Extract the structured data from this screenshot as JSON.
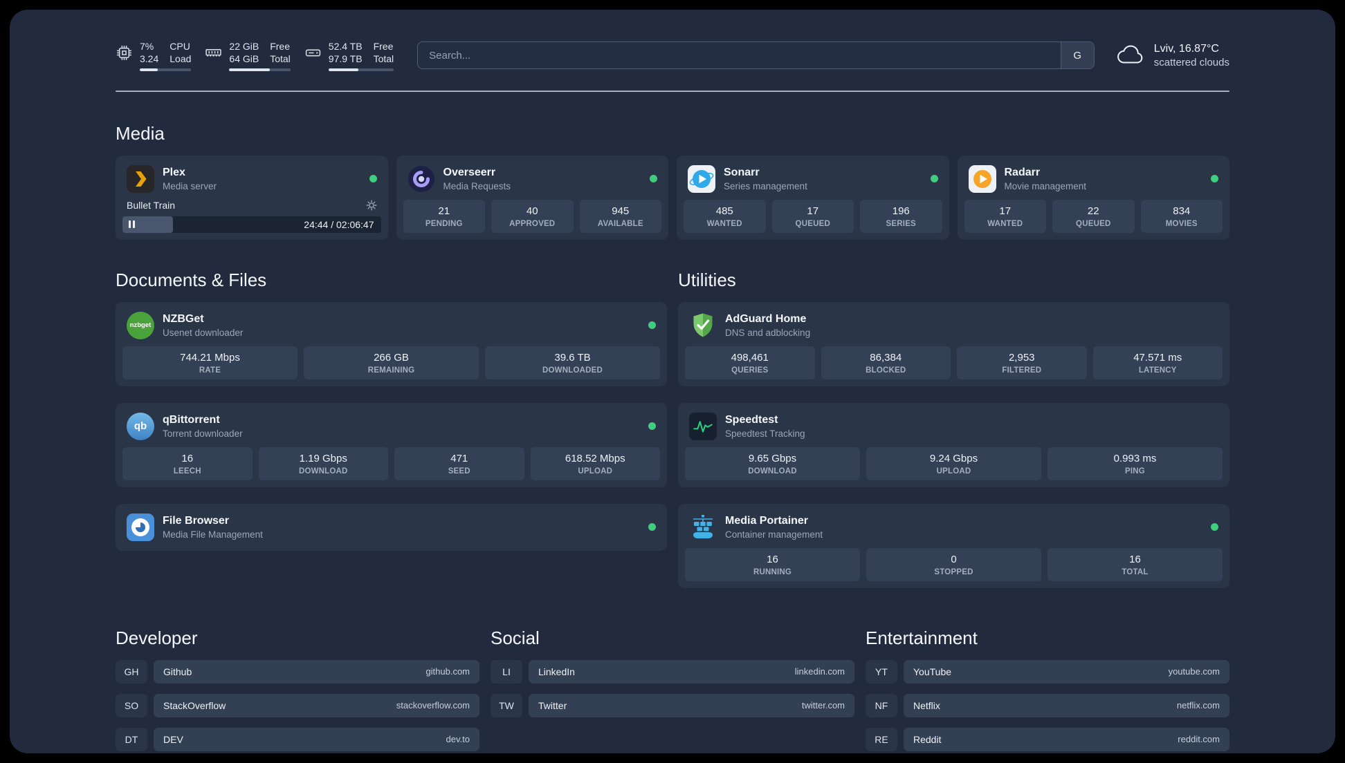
{
  "topbar": {
    "cpu": {
      "percent": "7%",
      "load": "3.24",
      "label_top": "CPU",
      "label_bottom": "Load",
      "bar_percent": 35
    },
    "memory": {
      "free": "22 GiB",
      "total": "64 GiB",
      "label_top": "Free",
      "label_bottom": "Total",
      "bar_percent": 66
    },
    "disk": {
      "free": "52.4 TB",
      "total": "97.9 TB",
      "label_top": "Free",
      "label_bottom": "Total",
      "bar_percent": 46
    },
    "search": {
      "placeholder": "Search...",
      "button_label": "G"
    },
    "weather": {
      "location": "Lviv, 16.87°C",
      "condition": "scattered clouds"
    }
  },
  "media": {
    "title": "Media",
    "plex": {
      "name": "Plex",
      "description": "Media server",
      "status": "online",
      "now_playing": "Bullet Train",
      "time": "24:44 / 02:06:47",
      "progress_percent": 19.5
    },
    "overseerr": {
      "name": "Overseerr",
      "description": "Media Requests",
      "status": "online",
      "stats": [
        {
          "value": "21",
          "label": "PENDING"
        },
        {
          "value": "40",
          "label": "APPROVED"
        },
        {
          "value": "945",
          "label": "AVAILABLE"
        }
      ]
    },
    "sonarr": {
      "name": "Sonarr",
      "description": "Series management",
      "status": "online",
      "stats": [
        {
          "value": "485",
          "label": "WANTED"
        },
        {
          "value": "17",
          "label": "QUEUED"
        },
        {
          "value": "196",
          "label": "SERIES"
        }
      ]
    },
    "radarr": {
      "name": "Radarr",
      "description": "Movie management",
      "status": "online",
      "stats": [
        {
          "value": "17",
          "label": "WANTED"
        },
        {
          "value": "22",
          "label": "QUEUED"
        },
        {
          "value": "834",
          "label": "MOVIES"
        }
      ]
    }
  },
  "documents": {
    "title": "Documents & Files",
    "nzbget": {
      "name": "NZBGet",
      "description": "Usenet downloader",
      "status": "online",
      "icon_text": "nzbget",
      "stats": [
        {
          "value": "744.21 Mbps",
          "label": "RATE"
        },
        {
          "value": "266 GB",
          "label": "REMAINING"
        },
        {
          "value": "39.6 TB",
          "label": "DOWNLOADED"
        }
      ]
    },
    "qbittorrent": {
      "name": "qBittorrent",
      "description": "Torrent downloader",
      "status": "online",
      "icon_text": "qb",
      "stats": [
        {
          "value": "16",
          "label": "LEECH"
        },
        {
          "value": "1.19 Gbps",
          "label": "DOWNLOAD"
        },
        {
          "value": "471",
          "label": "SEED"
        },
        {
          "value": "618.52 Mbps",
          "label": "UPLOAD"
        }
      ]
    },
    "filebrowser": {
      "name": "File Browser",
      "description": "Media File Management",
      "status": "online"
    }
  },
  "utilities": {
    "title": "Utilities",
    "adguard": {
      "name": "AdGuard Home",
      "description": "DNS and adblocking",
      "stats": [
        {
          "value": "498,461",
          "label": "QUERIES"
        },
        {
          "value": "86,384",
          "label": "BLOCKED"
        },
        {
          "value": "2,953",
          "label": "FILTERED"
        },
        {
          "value": "47.571 ms",
          "label": "LATENCY"
        }
      ]
    },
    "speedtest": {
      "name": "Speedtest",
      "description": "Speedtest Tracking",
      "stats": [
        {
          "value": "9.65 Gbps",
          "label": "DOWNLOAD"
        },
        {
          "value": "9.24 Gbps",
          "label": "UPLOAD"
        },
        {
          "value": "0.993 ms",
          "label": "PING"
        }
      ]
    },
    "portainer": {
      "name": "Media Portainer",
      "description": "Container management",
      "status": "online",
      "stats": [
        {
          "value": "16",
          "label": "RUNNING"
        },
        {
          "value": "0",
          "label": "STOPPED"
        },
        {
          "value": "16",
          "label": "TOTAL"
        }
      ]
    }
  },
  "bookmarks": {
    "developer": {
      "title": "Developer",
      "items": [
        {
          "abbr": "GH",
          "name": "Github",
          "href": "github.com"
        },
        {
          "abbr": "SO",
          "name": "StackOverflow",
          "href": "stackoverflow.com"
        },
        {
          "abbr": "DT",
          "name": "DEV",
          "href": "dev.to"
        }
      ]
    },
    "social": {
      "title": "Social",
      "items": [
        {
          "abbr": "LI",
          "name": "LinkedIn",
          "href": "linkedin.com"
        },
        {
          "abbr": "TW",
          "name": "Twitter",
          "href": "twitter.com"
        }
      ]
    },
    "entertainment": {
      "title": "Entertainment",
      "items": [
        {
          "abbr": "YT",
          "name": "YouTube",
          "href": "youtube.com"
        },
        {
          "abbr": "NF",
          "name": "Netflix",
          "href": "netflix.com"
        },
        {
          "abbr": "RE",
          "name": "Reddit",
          "href": "reddit.com"
        }
      ]
    }
  },
  "colors": {
    "background": "#212b3d",
    "card": "#2a3548",
    "tile": "#344055",
    "status_online": "#3dcf7e",
    "plex_accent": "#e8a00c",
    "adguard_green": "#55a54a",
    "speedtest_green": "#2bd07f",
    "portainer_blue": "#41b2e8"
  }
}
